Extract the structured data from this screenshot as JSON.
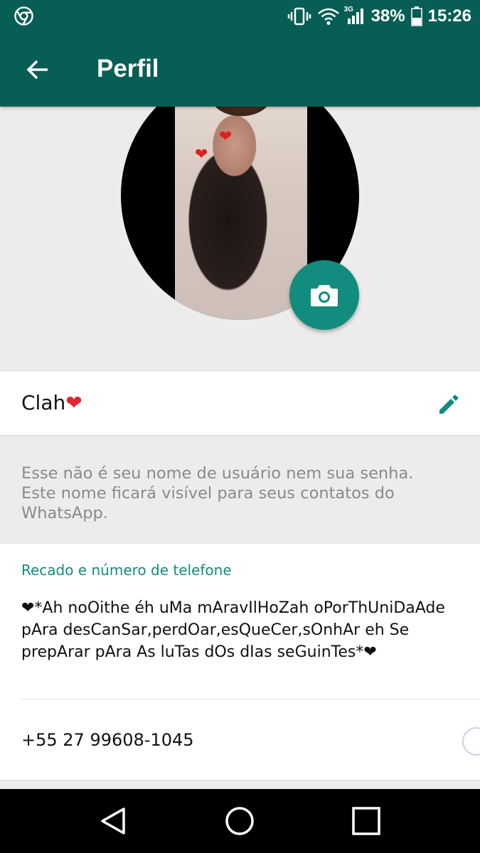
{
  "status_bar": {
    "battery_percent": "38%",
    "network_type": "3G",
    "time": "15:26",
    "icons": [
      "chrome-icon",
      "vibrate-icon",
      "wifi-icon",
      "signal-icon",
      "battery-icon"
    ]
  },
  "toolbar": {
    "title": "Perfil",
    "back_icon": "back-arrow-icon"
  },
  "profile": {
    "camera_icon": "camera-icon",
    "name": "Clah",
    "name_emoji": "❤",
    "edit_icon": "pencil-icon",
    "hint": "Esse não é seu nome de usuário nem sua senha. Este nome ficará visível para seus contatos do WhatsApp."
  },
  "about": {
    "header": "Recado e número de telefone",
    "text": "❤*Ah noOithe éh uMa mAravIlHoZah oPorThUniDaAde pAra desCanSar,perdOar,esQueCer,sOnhAr eh Se prepArar pAra As luTas dOs dIas seGuinTes*❤",
    "phone": "+55 27 99608-1045"
  },
  "nav": {
    "back_icon": "nav-back-icon",
    "home_icon": "nav-home-icon",
    "recents_icon": "nav-recents-icon"
  },
  "colors": {
    "toolbar": "#075e54",
    "accent": "#128c7e",
    "heart": "#e0262e",
    "background": "#ececec"
  }
}
